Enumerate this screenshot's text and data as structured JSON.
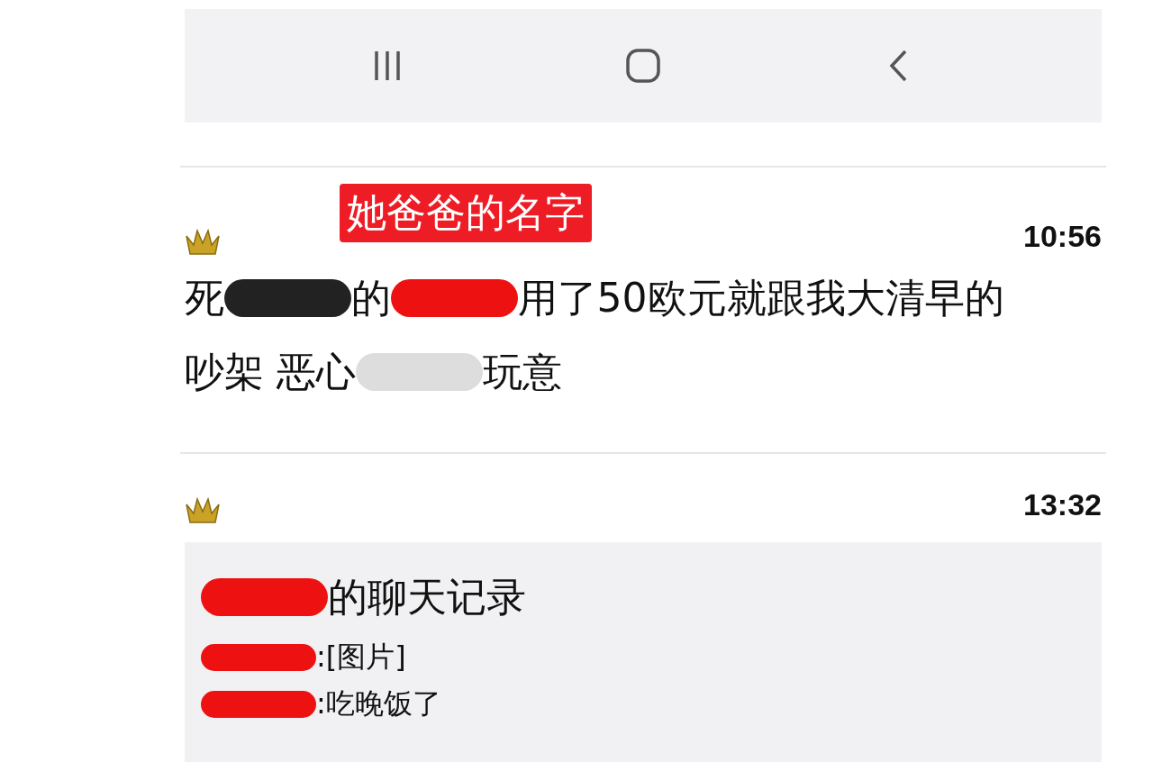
{
  "nav_bar": {
    "buttons": [
      {
        "kind": "recents"
      },
      {
        "kind": "home"
      },
      {
        "kind": "back"
      }
    ]
  },
  "messages": [
    {
      "annotation": "她爸爸的名字",
      "time": "10:56",
      "kind": "text",
      "lines": [
        [
          {
            "kind": "text",
            "text": "死"
          },
          {
            "kind": "redaction",
            "color": "#222222"
          },
          {
            "kind": "text",
            "text": "的"
          },
          {
            "kind": "redaction",
            "color": "#ee1111"
          },
          {
            "kind": "text",
            "text": "用了50欧元就跟我大清早的"
          }
        ],
        [
          {
            "kind": "text",
            "text": "吵架 恶心"
          },
          {
            "kind": "redaction",
            "color": "#dddddd"
          },
          {
            "kind": "text",
            "text": "玩意"
          }
        ]
      ]
    },
    {
      "time": "13:32",
      "kind": "forward",
      "title": [
        {
          "kind": "redaction",
          "color": "#ee1111"
        },
        {
          "kind": "text",
          "text": "的聊天记录"
        }
      ],
      "lines": [
        [
          {
            "kind": "redaction",
            "color": "#ee1111"
          },
          {
            "kind": "text",
            "text": ":[图片]"
          }
        ],
        [
          {
            "kind": "redaction",
            "color": "#ee1111"
          },
          {
            "kind": "text",
            "text": ":吃晚饭了"
          }
        ]
      ]
    }
  ]
}
